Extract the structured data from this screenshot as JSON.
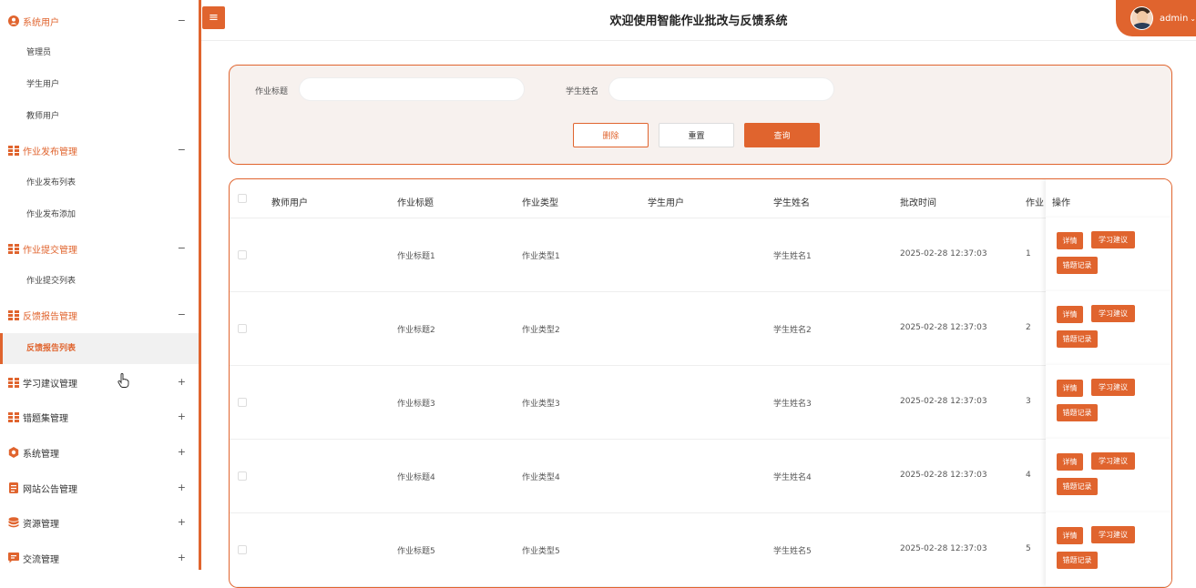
{
  "header": {
    "title": "欢迎使用智能作业批改与反馈系统",
    "menu_icon": "hamburger-icon",
    "user": {
      "name": "admin",
      "caret": "⌄"
    }
  },
  "sidebar": {
    "groups": [
      {
        "label": "系统用户",
        "icon": "user-circle-icon",
        "toggle": "−",
        "items": [
          "管理员",
          "学生用户",
          "教师用户"
        ]
      },
      {
        "label": "作业发布管理",
        "icon": "grid-icon",
        "toggle": "−",
        "items": [
          "作业发布列表",
          "作业发布添加"
        ]
      },
      {
        "label": "作业提交管理",
        "icon": "grid-icon",
        "toggle": "−",
        "items": [
          "作业提交列表"
        ]
      },
      {
        "label": "反馈报告管理",
        "icon": "grid-icon",
        "toggle": "−",
        "items": [
          "反馈报告列表"
        ]
      },
      {
        "label": "学习建议管理",
        "icon": "grid-icon",
        "toggle": "+"
      },
      {
        "label": "错题集管理",
        "icon": "grid-icon",
        "toggle": "+"
      },
      {
        "label": "系统管理",
        "icon": "gear-icon",
        "toggle": "+"
      },
      {
        "label": "网站公告管理",
        "icon": "document-icon",
        "toggle": "+"
      },
      {
        "label": "资源管理",
        "icon": "database-icon",
        "toggle": "+"
      },
      {
        "label": "交流管理",
        "icon": "chat-icon",
        "toggle": "+"
      }
    ],
    "active_item": "反馈报告列表"
  },
  "search": {
    "title_label": "作业标题",
    "title_value": "",
    "student_label": "学生姓名",
    "student_value": "",
    "buttons": {
      "delete": "删除",
      "reset": "重置",
      "search": "查询"
    }
  },
  "table": {
    "columns": [
      "教师用户",
      "作业标题",
      "作业类型",
      "学生用户",
      "学生姓名",
      "批改时间",
      "作业",
      "操作"
    ],
    "rows": [
      {
        "teacher": "",
        "title": "作业标题1",
        "type": "作业类型1",
        "student_user": "",
        "student_name": "学生姓名1",
        "time": "2025-02-28 12:37:03",
        "hw": "1"
      },
      {
        "teacher": "",
        "title": "作业标题2",
        "type": "作业类型2",
        "student_user": "",
        "student_name": "学生姓名2",
        "time": "2025-02-28 12:37:03",
        "hw": "2"
      },
      {
        "teacher": "",
        "title": "作业标题3",
        "type": "作业类型3",
        "student_user": "",
        "student_name": "学生姓名3",
        "time": "2025-02-28 12:37:03",
        "hw": "3"
      },
      {
        "teacher": "",
        "title": "作业标题4",
        "type": "作业类型4",
        "student_user": "",
        "student_name": "学生姓名4",
        "time": "2025-02-28 12:37:03",
        "hw": "4"
      },
      {
        "teacher": "",
        "title": "作业标题5",
        "type": "作业类型5",
        "student_user": "",
        "student_name": "学生姓名5",
        "time": "2025-02-28 12:37:03",
        "hw": "5"
      }
    ],
    "row_actions": {
      "detail": "详情",
      "advice": "学习建议",
      "wrong": "错题记录"
    }
  },
  "colors": {
    "accent": "#e0642e",
    "panel_bg": "#f7f1ee",
    "active_bg": "#f1f1f1"
  }
}
